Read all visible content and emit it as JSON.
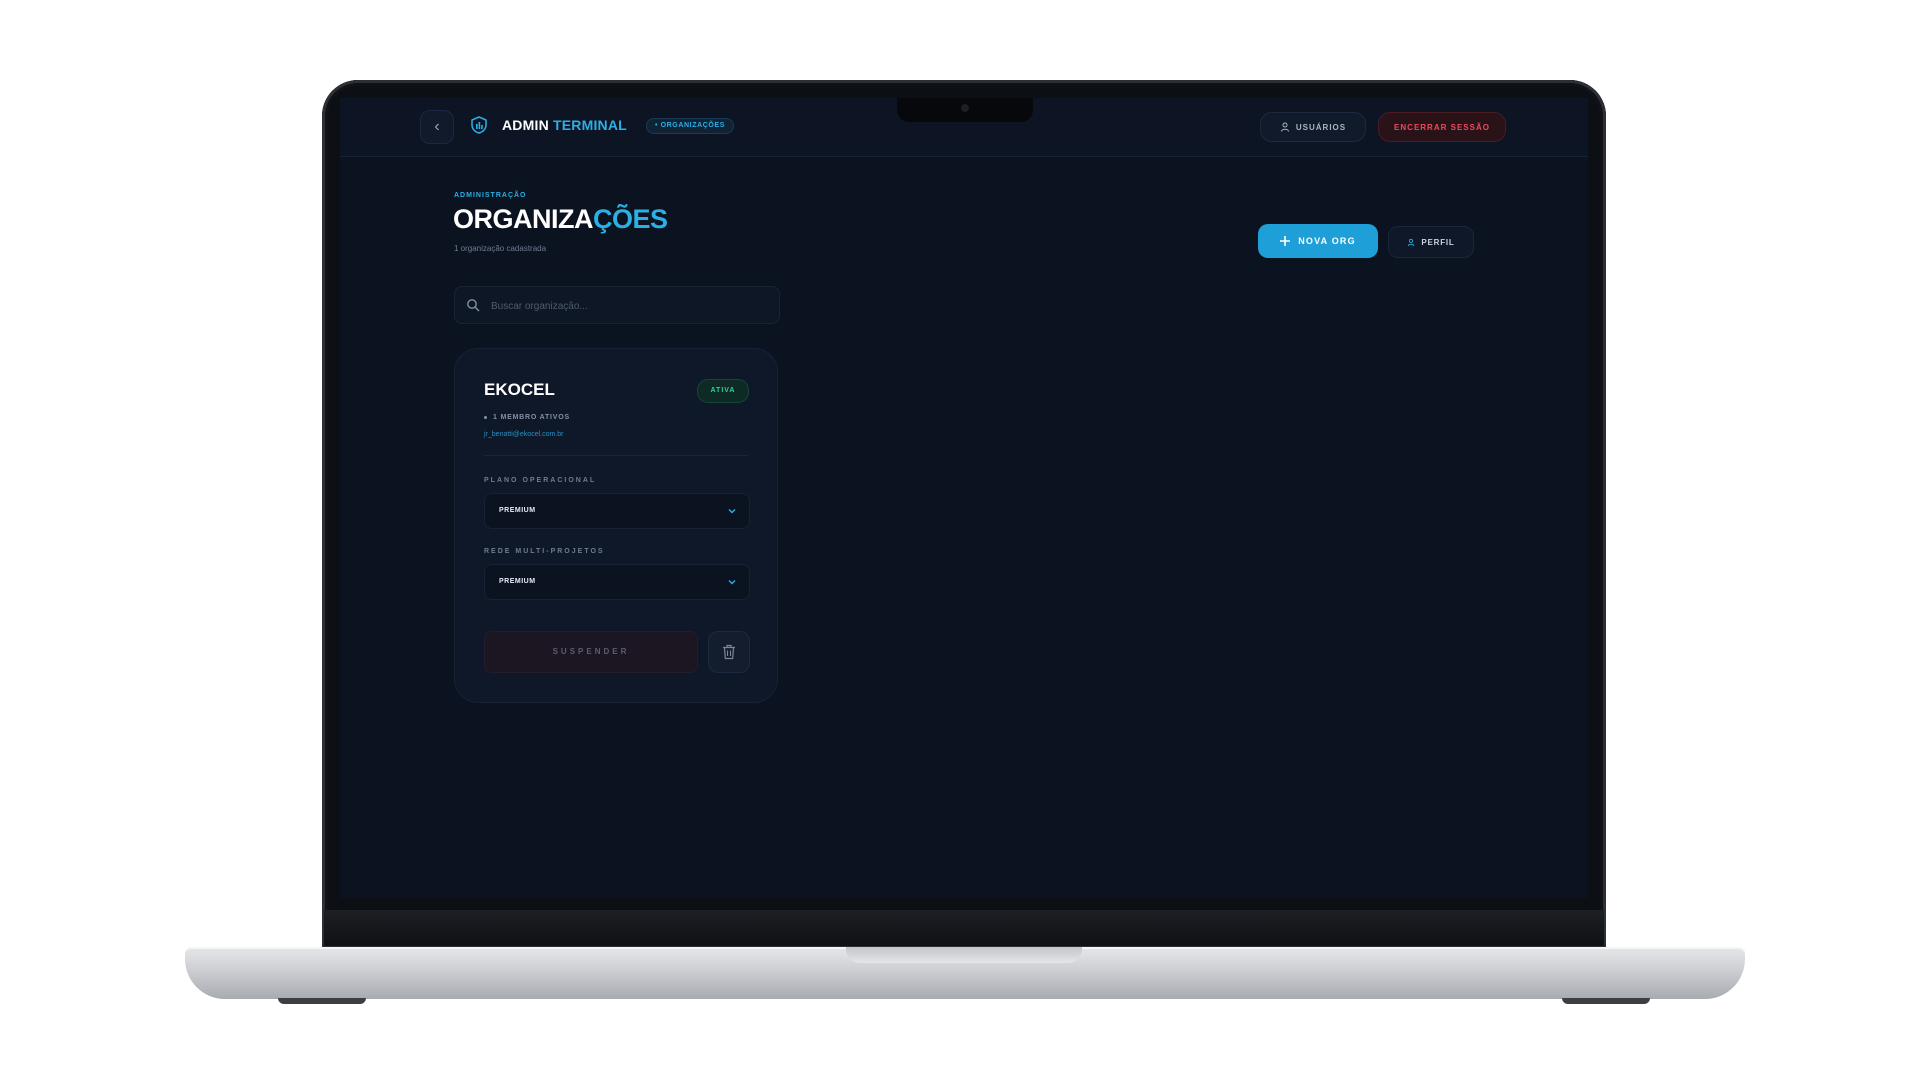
{
  "topbar": {
    "brand_primary": "ADMIN",
    "brand_accent": "TERMINAL",
    "breadcrumb": "• ORGANIZAÇÕES",
    "users_label": "USUÁRIOS",
    "logout_label": "ENCERRAR SESSÃO"
  },
  "header": {
    "kicker": "ADMINISTRAÇÃO",
    "title_primary": "ORGANIZA",
    "title_accent": "ÇÕES",
    "subtitle": "1 organização cadastrada",
    "new_org_label": "NOVA ORG",
    "profile_label": "PERFIL"
  },
  "search": {
    "placeholder": "Buscar organização..."
  },
  "organizations": [
    {
      "name": "EKOCEL",
      "status": "ATIVA",
      "members": "1 MEMBRO ATIVOS",
      "email": "jr_benatti@ekocel.com.br",
      "plan_label": "PLANO OPERACIONAL",
      "plan_value": "PREMIUM",
      "network_label": "REDE MULTI-PROJETOS",
      "network_value": "PREMIUM",
      "suspend_label": "SUSPENDER"
    }
  ],
  "colors": {
    "accent": "#2bb0e6",
    "background": "#0b1220",
    "danger": "#ef4a5a",
    "success": "#2fd19b"
  },
  "icons": {
    "back": "chevron-left-icon",
    "brand": "shield-chart-icon",
    "users": "user-icon",
    "add": "plus-icon",
    "profile": "user-icon",
    "search": "search-icon",
    "select": "chevron-down-icon",
    "delete": "trash-icon"
  }
}
